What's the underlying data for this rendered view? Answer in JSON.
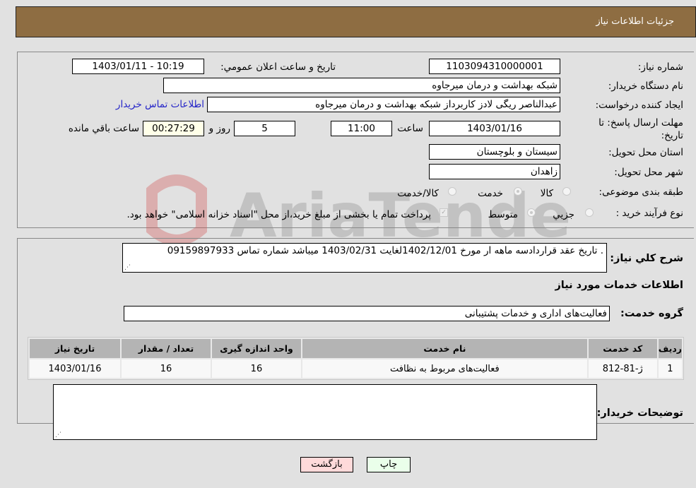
{
  "header": {
    "title": "جزئیات اطلاعات نیاز"
  },
  "fields": {
    "need_number": {
      "label": "شماره نیاز:",
      "value": "1103094310000001"
    },
    "announce_datetime": {
      "label": "تاریخ و ساعت اعلان عمومي:",
      "value": "1403/01/11 - 10:19"
    },
    "buyer_org": {
      "label": "نام دستگاه خریدار:",
      "value": "شبکه بهداشت و درمان میرجاوه"
    },
    "requester": {
      "label": "ایجاد کننده درخواست:",
      "value": "عبدالناصر  ریگی لادز کاربرداز شبکه بهداشت و درمان میرجاوه"
    },
    "buyer_contact_link": "اطلاعات تماس خریدار",
    "deadline": {
      "label": "مهلت ارسال پاسخ: تا تاریخ:",
      "date": "1403/01/16",
      "time_label": "ساعت",
      "time": "11:00",
      "days": "5",
      "days_label": "روز و",
      "remaining": "00:27:29",
      "remaining_label": "ساعت باقي مانده"
    },
    "province": {
      "label": "استان محل تحویل:",
      "value": "سیستان و بلوچستان"
    },
    "city": {
      "label": "شهر محل تحویل:",
      "value": "زاهدان"
    },
    "category": {
      "label": "طبقه بندی موضوعی:",
      "options": [
        "کالا",
        "خدمت",
        "کالا/خدمت"
      ],
      "selected": "خدمت"
    },
    "purchase_type": {
      "label": "نوع فرآیند خرید :",
      "options": [
        "جزيي",
        "متوسط"
      ],
      "selected": "متوسط",
      "treasury_checkbox_label": "پرداخت تمام یا بخشی از مبلغ خرید،از محل \"اسناد خزانه اسلامی\" خواهد بود.",
      "treasury_checked": true
    }
  },
  "description": {
    "label": "شرح کلي نیاز:",
    "value": ". تاریخ عقد قراردادسه ماهه ار مورخ 1402/12/01لغایت 1403/02/31 میباشد شماره تماس 09159897933"
  },
  "services_section_title": "اطلاعات خدمات مورد نیاز",
  "service_group": {
    "label": "گروه خدمت:",
    "value": "فعالیت‌های اداری و خدمات پشتیبانی"
  },
  "table": {
    "headers": [
      "ردیف",
      "کد خدمت",
      "نام خدمت",
      "واحد اندازه گیری",
      "تعداد / مقدار",
      "تاریخ نیاز"
    ],
    "rows": [
      [
        "1",
        "ژ-81-812",
        "فعالیت‌های مربوط به نظافت",
        "16",
        "16",
        "1403/01/16"
      ]
    ]
  },
  "buyer_notes": {
    "label": "توضیحات خریدار:",
    "value": ""
  },
  "buttons": {
    "print": "چاپ",
    "back": "بازگشت"
  },
  "watermark": "AriaTender.neT"
}
